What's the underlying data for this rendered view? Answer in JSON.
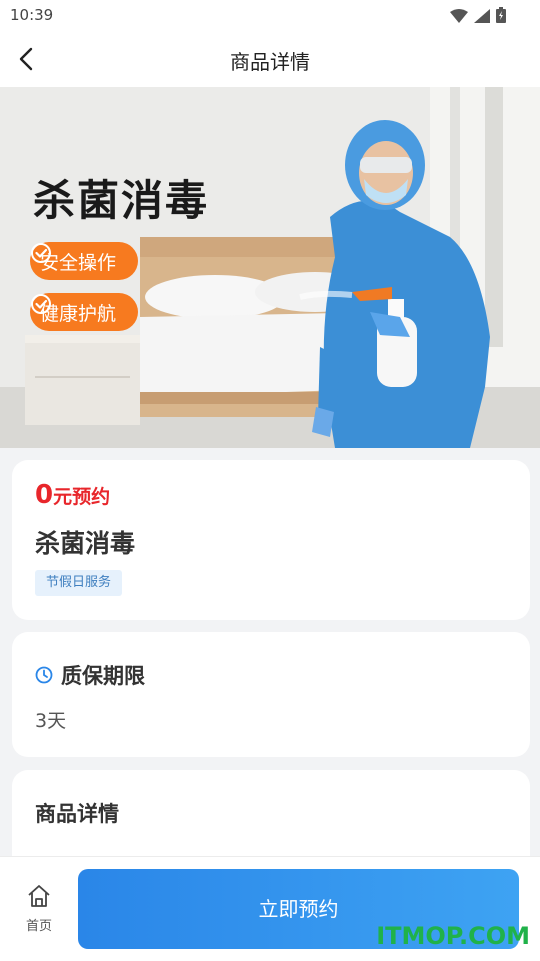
{
  "status_bar": {
    "time": "10:39"
  },
  "nav": {
    "title": "商品详情"
  },
  "banner": {
    "title": "杀菌消毒",
    "badges": [
      "安全操作",
      "健康护航"
    ],
    "badge_color": "#f77a1f"
  },
  "product": {
    "price_number": "0",
    "price_suffix": "元预约",
    "name": "杀菌消毒",
    "tag": "节假日服务",
    "price_color": "#e8262b"
  },
  "warranty": {
    "title": "质保期限",
    "value": "3天"
  },
  "details": {
    "title": "商品详情"
  },
  "bottom_bar": {
    "home_label": "首页",
    "book_label": "立即预约",
    "accent": "#2a86e8"
  },
  "watermark": {
    "text": "ITMOP.COM",
    "color": "#20b24a"
  },
  "icons": {
    "back": "chevron-left-icon",
    "wifi": "wifi-icon",
    "signal": "signal-icon",
    "battery": "battery-icon",
    "check": "check-circle-icon",
    "clock": "clock-icon",
    "home": "home-icon"
  }
}
